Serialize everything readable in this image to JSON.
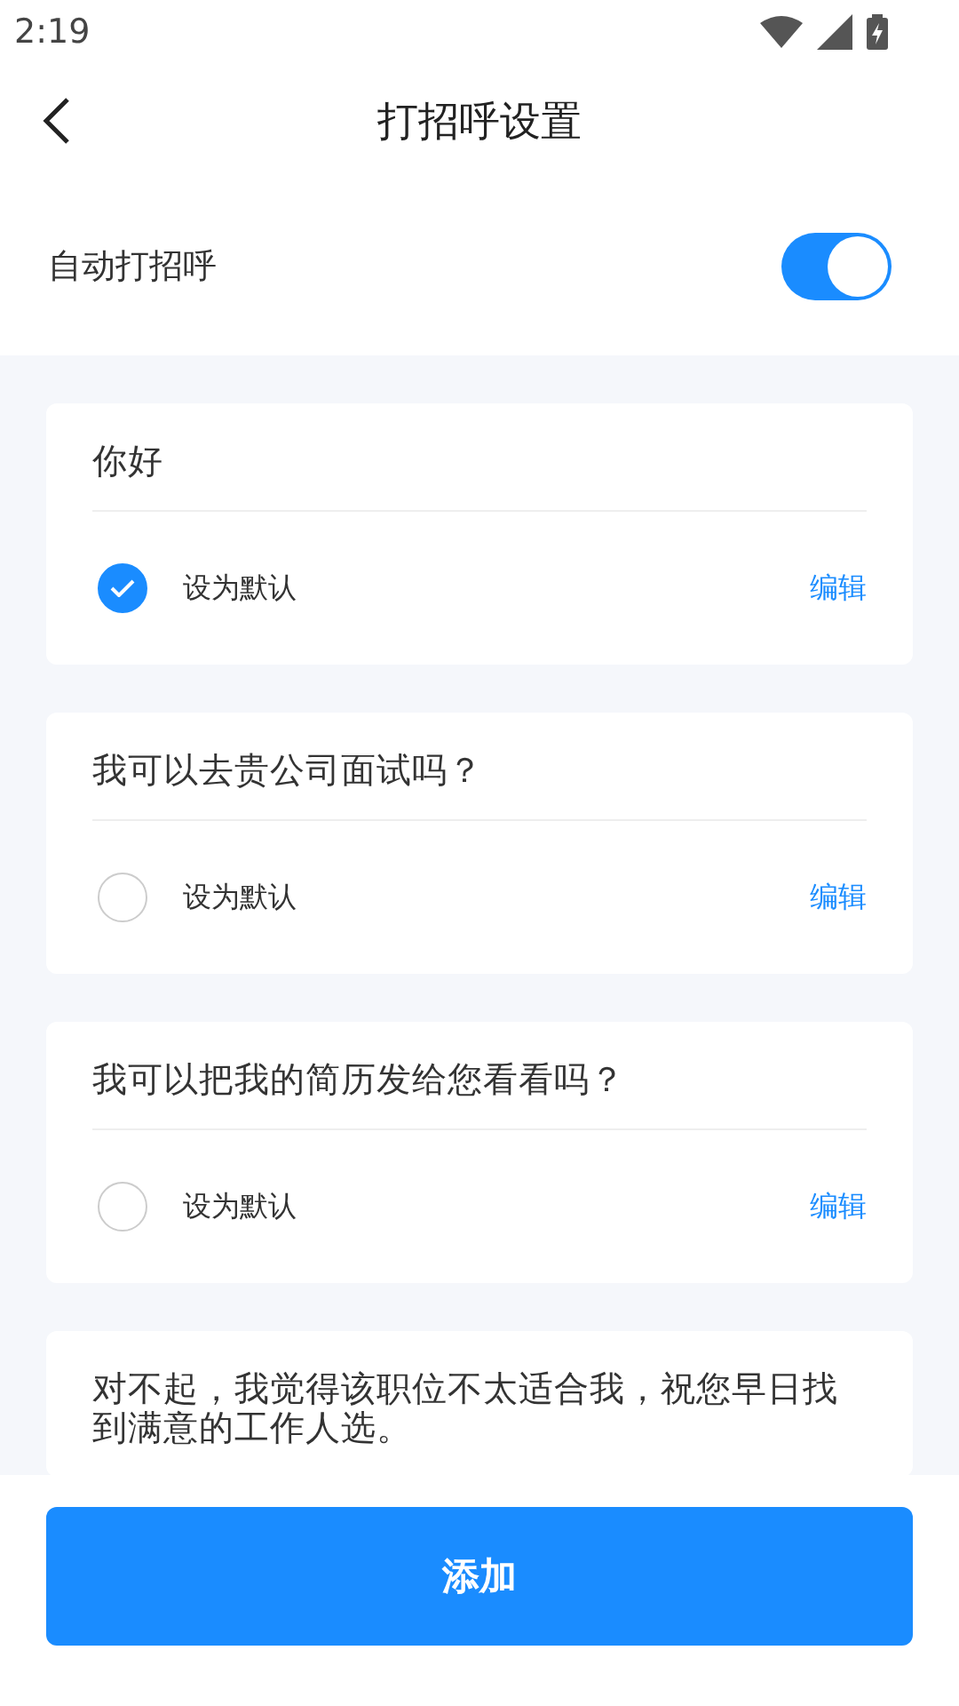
{
  "status_bar": {
    "time": "2:19"
  },
  "header": {
    "title": "打招呼设置"
  },
  "auto_greet": {
    "label": "自动打招呼",
    "on": true
  },
  "greetings": [
    {
      "text": "你好",
      "default_label": "设为默认",
      "selected": true,
      "edit": "编辑"
    },
    {
      "text": "我可以去贵公司面试吗？",
      "default_label": "设为默认",
      "selected": false,
      "edit": "编辑"
    },
    {
      "text": "我可以把我的简历发给您看看吗？",
      "default_label": "设为默认",
      "selected": false,
      "edit": "编辑"
    },
    {
      "text": "对不起，我觉得该职位不太适合我，祝您早日找到满意的工作人选。"
    }
  ],
  "add_button": {
    "label": "添加"
  }
}
